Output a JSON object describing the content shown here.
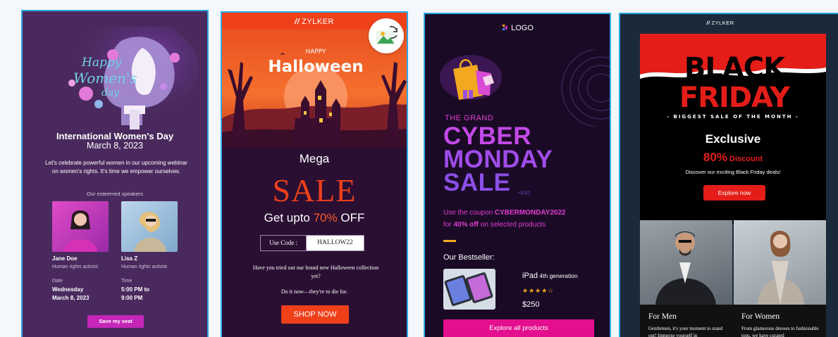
{
  "card1": {
    "hero_text": [
      "Happy",
      "Women's",
      "day"
    ],
    "title": "International Women's Day",
    "date": "March 8, 2023",
    "description": "Let's celebrate powerful women in our upcoming webinar on women's rights. It's time we empower ourselves.",
    "speakers_heading": "Our esteemed speakers",
    "speakers": [
      {
        "name": "Jane Doe",
        "role": "Human rights activist"
      },
      {
        "name": "Lisa Z",
        "role": "Human rights activist"
      }
    ],
    "date_label": "Date",
    "date_value": "Wednesday March 8, 2023",
    "time_label": "Time",
    "time_value": "5:00 PM to 9:00 PM",
    "button": "Save my seat",
    "colors": {
      "bg": "#4a2a5e",
      "button": "#c526b8"
    }
  },
  "card2": {
    "brand": "ZYLKER",
    "hero_small": "HAPPY",
    "hero_big": "Halloween",
    "mega": "Mega",
    "sale": "SALE",
    "get_prefix": "Get upto ",
    "get_pct": "70%",
    "get_suffix": " OFF",
    "code_label": "Use Code :",
    "code_value": "HALLOW22",
    "para1": "Have you tried out our brand new Halloween collection yet?",
    "para2": "Do it now—they're to die for.",
    "button": "SHOP NOW",
    "icon": "image-swap-icon",
    "colors": {
      "accent": "#f0401a",
      "bg": "#2a0f33"
    }
  },
  "card3": {
    "logo": "LOGO",
    "grand": "THE GRAND",
    "line1": "CYBER",
    "line2": "MONDAY",
    "line3": "SALE",
    "arrows": "◁◁◁",
    "coupon_prefix": "Use the coupon ",
    "coupon_code": "CYBERMONDAY2022",
    "coupon_for": "for ",
    "coupon_pct": "40% off",
    "coupon_suffix": " on selected products",
    "bestseller": "Our Bestseller:",
    "product_name": "iPad",
    "product_gen": " 4th generation",
    "rating": 4,
    "stars": "★★★★☆",
    "price": "$250",
    "button": "Explore all products",
    "colors": {
      "bg": "#1a0a26",
      "accent": "#e23ccf",
      "button": "#e40f8e",
      "gold": "#f2a91f"
    }
  },
  "card4": {
    "brand": "ZYLKER",
    "hero_line1": "BLACK",
    "hero_line2": "FRIDAY",
    "hero_tag": "- BIGGEST SALE OF THE MONTH -",
    "exclusive": "Exclusive",
    "pct": "80%",
    "discount": " Discount",
    "subtitle": "Discover our exciting Black Friday deals!",
    "button": "Explore now",
    "men_title": "For Men",
    "men_text": "Gentlemen, it's your moment to stand out! Immerse yourself in",
    "women_title": "For Women",
    "women_text": "From glamorous dresses to fashionable tops, we have curated",
    "colors": {
      "accent": "#e51d18",
      "panel": "#000000"
    }
  }
}
